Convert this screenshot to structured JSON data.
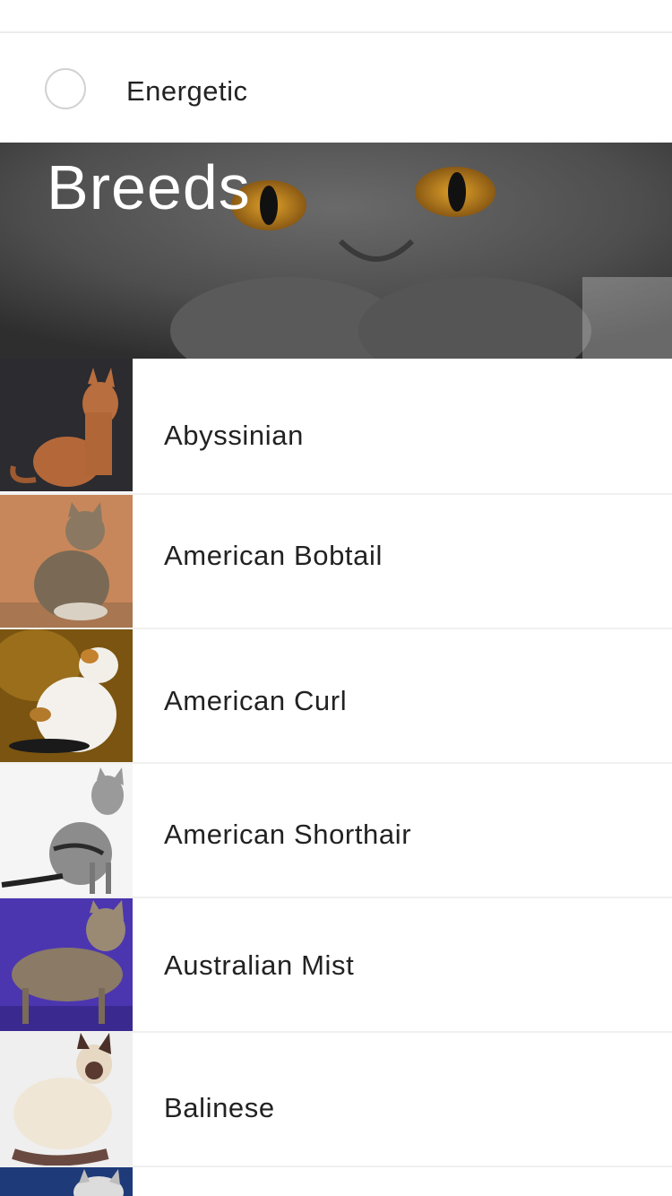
{
  "filter": {
    "label": "Energetic",
    "selected": false
  },
  "hero": {
    "title": "Breeds"
  },
  "breeds": [
    {
      "name": "Abyssinian"
    },
    {
      "name": "American Bobtail"
    },
    {
      "name": "American Curl"
    },
    {
      "name": "American Shorthair"
    },
    {
      "name": "Australian Mist"
    },
    {
      "name": "Balinese"
    }
  ]
}
